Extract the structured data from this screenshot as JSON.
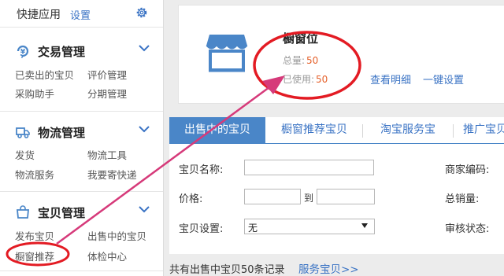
{
  "sidebar": {
    "header": {
      "title": "快捷应用",
      "settings_link": "设置"
    },
    "sections": [
      {
        "title": "交易管理",
        "icon": "yen-icon",
        "links": [
          "已卖出的宝贝",
          "评价管理",
          "采购助手",
          "分期管理"
        ]
      },
      {
        "title": "物流管理",
        "icon": "truck-icon",
        "links": [
          "发货",
          "物流工具",
          "物流服务",
          "我要寄快递"
        ]
      },
      {
        "title": "宝贝管理",
        "icon": "shop-bag-icon",
        "links": [
          "发布宝贝",
          "出售中的宝贝",
          "橱窗推荐",
          "体检中心"
        ]
      }
    ]
  },
  "showcase": {
    "title": "橱窗位",
    "total_label": "总量:",
    "total_value": "50",
    "used_label": "已使用:",
    "used_value": "50",
    "detail_link": "查看明细",
    "one_click_link": "一键设置"
  },
  "tabs": [
    "出售中的宝贝",
    "橱窗推荐宝贝",
    "淘宝服务宝",
    "推广宝贝"
  ],
  "form": {
    "name_label": "宝贝名称:",
    "merchant_code_label": "商家编码:",
    "price_label": "价格:",
    "price_to": "到",
    "total_sales_label": "总销量:",
    "setting_label": "宝贝设置:",
    "setting_value": "无",
    "review_status_label": "审核状态:"
  },
  "footer": {
    "total_text": "共有出售中宝贝50条记录",
    "service_link": "服务宝贝>>"
  },
  "colors": {
    "link": "#3a73c4",
    "tab_active": "#4a86c8",
    "highlight": "#e5602a",
    "annotation": "#e31b23",
    "arrow": "#d63a7a"
  }
}
